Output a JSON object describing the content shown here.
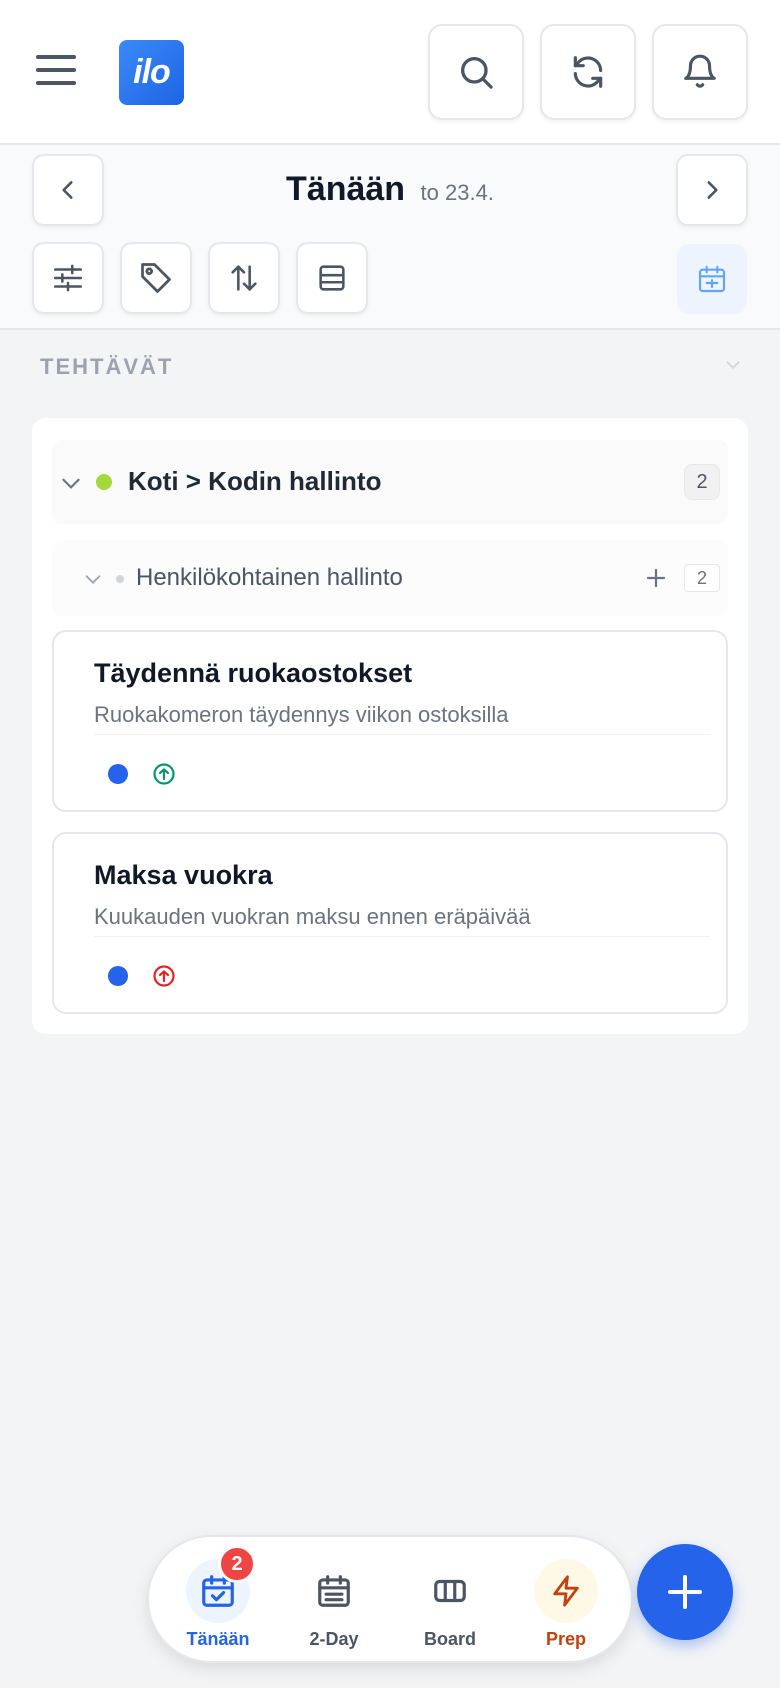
{
  "app": {
    "logo_text": "ilo",
    "brand_color": "#1d64e5"
  },
  "header": {
    "menu_icon": "hamburger-icon",
    "buttons": [
      {
        "name": "search",
        "icon": "search-icon"
      },
      {
        "name": "refresh",
        "icon": "refresh-icon"
      },
      {
        "name": "notifications",
        "icon": "bell-icon"
      }
    ]
  },
  "date_nav": {
    "title": "Tänään",
    "subtitle": "to 23.4.",
    "prev_icon": "chevron-left-icon",
    "next_icon": "chevron-right-icon"
  },
  "toolbar": {
    "buttons": [
      {
        "name": "filter",
        "icon": "sliders-icon"
      },
      {
        "name": "tags",
        "icon": "tag-icon"
      },
      {
        "name": "sort",
        "icon": "sort-icon"
      },
      {
        "name": "view",
        "icon": "list-view-icon"
      }
    ],
    "calendar_icon": "calendar-icon"
  },
  "section": {
    "title": "TEHTÄVÄT"
  },
  "group": {
    "label": "Koti > Kodin hallinto",
    "count": "2",
    "dot_color": "#a3d93b",
    "subgroup": {
      "label": "Henkilökohtainen hallinto",
      "count": "2"
    }
  },
  "tasks": [
    {
      "title": "Täydennä ruokaostokset",
      "description": "Ruokakomeron täydennys viikon ostoksilla",
      "dot_color": "#2563eb",
      "priority_color": "#059669",
      "priority_icon": "arrow-up-circle-icon"
    },
    {
      "title": "Maksa vuokra",
      "description": "Kuukauden vuokran maksu ennen eräpäivää",
      "dot_color": "#2563eb",
      "priority_color": "#dc2626",
      "priority_icon": "arrow-up-circle-icon"
    }
  ],
  "bottom_nav": {
    "items": [
      {
        "label": "Tänään",
        "icon": "calendar-check-icon",
        "active": true,
        "badge": "2"
      },
      {
        "label": "2-Day",
        "icon": "calendar-icon"
      },
      {
        "label": "Board",
        "icon": "columns-icon"
      },
      {
        "label": "Prep",
        "icon": "lightning-icon"
      }
    ],
    "fab_icon": "plus-icon"
  }
}
